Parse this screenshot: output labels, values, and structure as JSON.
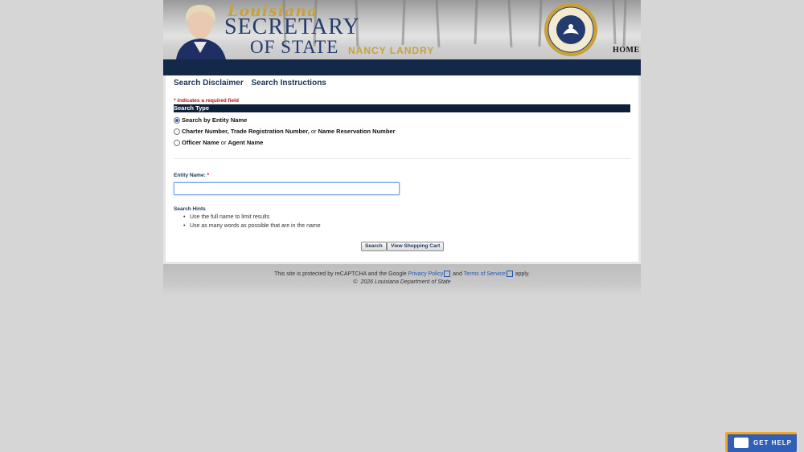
{
  "banner": {
    "script_title": "Louisiana",
    "main_title": "SECRETARY",
    "sub_title": "OF STATE",
    "name": "NANCY LANDRY",
    "home_label": "HOME"
  },
  "tabs": [
    "Search Disclaimer",
    "Search Instructions"
  ],
  "form": {
    "required_note": "* indicates a required field",
    "section_title": "Search Type",
    "options": [
      {
        "pre": "",
        "bold": "Search by Entity Name",
        "mid": "",
        "bold2": "",
        "mid2": "",
        "bold3": "",
        "selected": true
      },
      {
        "pre": "",
        "bold": "Charter Number, Trade Registration Number,",
        "mid": " or ",
        "bold2": "Name Reservation Number",
        "selected": false
      },
      {
        "pre": "",
        "bold": "Officer Name",
        "mid": " or ",
        "bold2": "Agent Name",
        "selected": false
      }
    ],
    "entity_label": "Entity Name:",
    "entity_required": "*",
    "entity_value": "",
    "hints_title": "Search Hints",
    "hints": [
      "Use the full name to limit results",
      "Use as many words as possible that are in the name"
    ],
    "search_button": "Search",
    "cart_button": "View Shopping Cart"
  },
  "footer": {
    "recaptcha_pre": "This site is protected by reCAPTCHA and the Google",
    "privacy": "Privacy Policy",
    "and": "and",
    "terms": "Terms of Service",
    "apply": "apply.",
    "copyright_symbol": "©",
    "copyright_text": "2026 Louisiana Department of State"
  },
  "help_widget": {
    "label": "GET HELP"
  },
  "colors": {
    "navy": "#14294a",
    "gold": "#c9a13a",
    "required_red": "#b11111",
    "help_orange": "#f5a623",
    "help_blue": "#2f5fb6"
  }
}
